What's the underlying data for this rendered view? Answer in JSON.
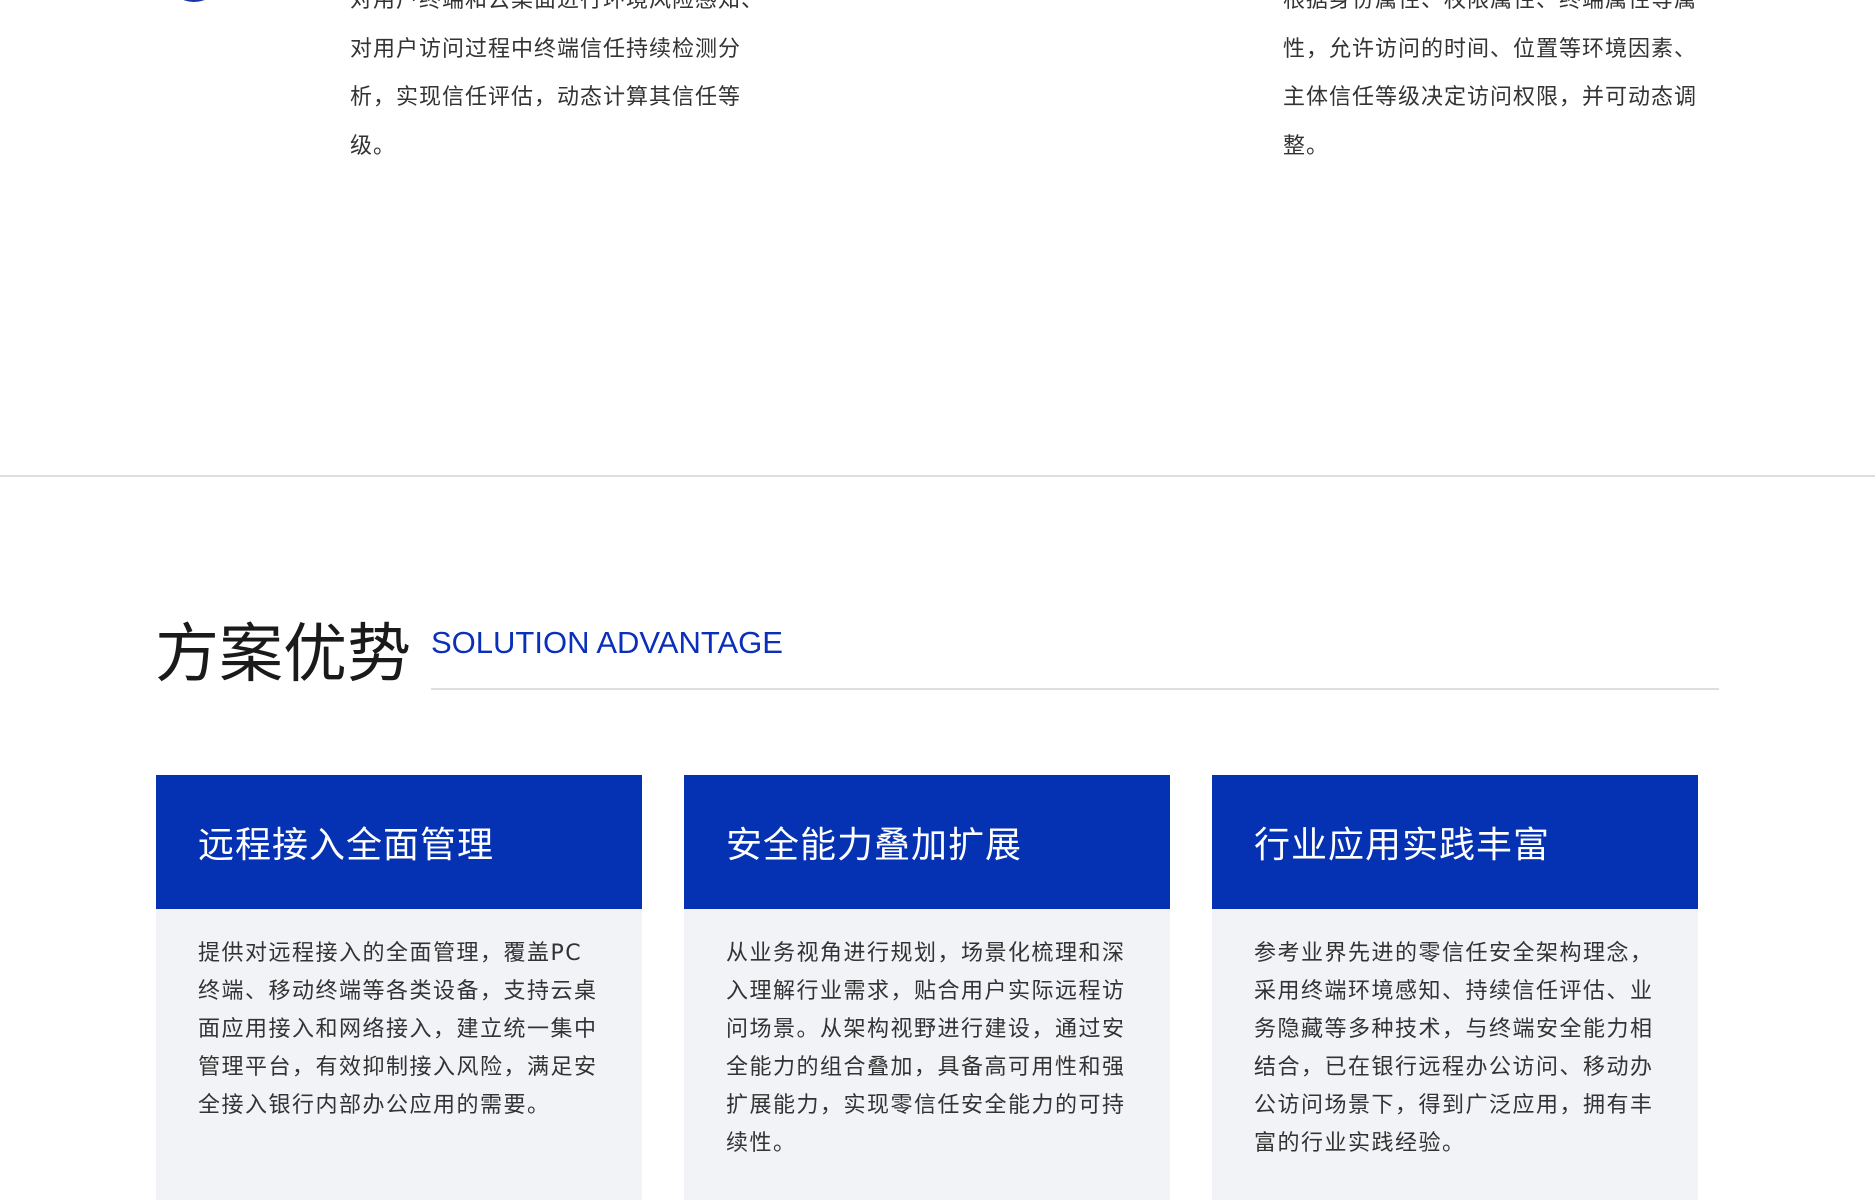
{
  "top_features": {
    "left": {
      "icon": "circle-outline-icon",
      "text": "对用户终端和云桌面进行环境风险感知、对用户访问过程中终端信任持续检测分析，实现信任评估，动态计算其信任等级。"
    },
    "right": {
      "text": "根据身份属性、权限属性、终端属性等属性，允许访问的时间、位置等环境因素、主体信任等级决定访问权限，并可动态调整。"
    }
  },
  "solution": {
    "title": "方案优势",
    "subtitle": "SOLUTION ADVANTAGE",
    "accent_color": "#0532b3",
    "cards": [
      {
        "title": "远程接入全面管理",
        "body": "提供对远程接入的全面管理，覆盖PC终端、移动终端等各类设备，支持云桌面应用接入和网络接入，建立统一集中管理平台，有效抑制接入风险，满足安全接入银行内部办公应用的需要。"
      },
      {
        "title": "安全能力叠加扩展",
        "body": "从业务视角进行规划，场景化梳理和深入理解行业需求，贴合用户实际远程访问场景。从架构视野进行建设，通过安全能力的组合叠加，具备高可用性和强扩展能力，实现零信任安全能力的可持续性。"
      },
      {
        "title": "行业应用实践丰富",
        "body": "参考业界先进的零信任安全架构理念，采用终端环境感知、持续信任评估、业务隐藏等多种技术，与终端安全能力相结合，已在银行远程办公访问、移动办公访问场景下，得到广泛应用，拥有丰富的行业实践经验。"
      }
    ]
  }
}
